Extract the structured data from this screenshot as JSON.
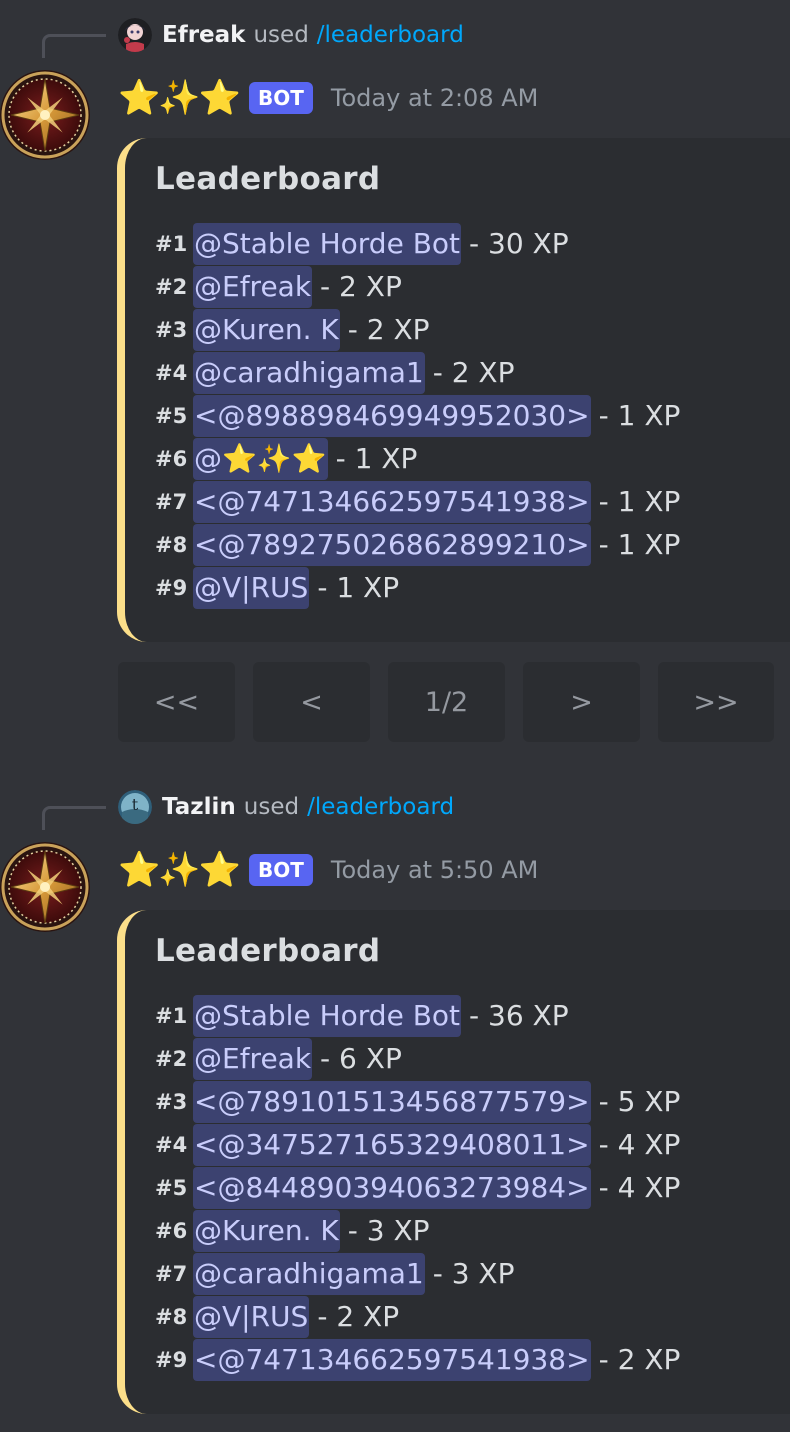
{
  "messages": [
    {
      "reply": {
        "user": "Efreak",
        "used": "used",
        "command": "/leaderboard"
      },
      "bot": {
        "name": "⭐✨⭐",
        "tag": "BOT",
        "timestamp": "Today at 2:08 AM"
      },
      "embed": {
        "title": "Leaderboard",
        "rows": [
          {
            "rank": "#1",
            "mention": "@Stable Horde Bot",
            "xp": "- 30 XP"
          },
          {
            "rank": "#2",
            "mention": "@Efreak",
            "xp": "- 2 XP"
          },
          {
            "rank": "#3",
            "mention": "@Kuren. K",
            "xp": "- 2 XP"
          },
          {
            "rank": "#4",
            "mention": "@caradhigama1",
            "xp": "- 2 XP"
          },
          {
            "rank": "#5",
            "mention": "<@898898469949952030>",
            "xp": "- 1 XP"
          },
          {
            "rank": "#6",
            "mention": "@⭐✨⭐",
            "xp": "- 1 XP"
          },
          {
            "rank": "#7",
            "mention": "<@747134662597541938>",
            "xp": "- 1 XP"
          },
          {
            "rank": "#8",
            "mention": "<@789275026862899210>",
            "xp": "- 1 XP"
          },
          {
            "rank": "#9",
            "mention": "@V|RUS",
            "xp": "- 1 XP"
          }
        ]
      },
      "pagination": {
        "first": "<<",
        "prev": "<",
        "page": "1/2",
        "next": ">",
        "last": ">>"
      }
    },
    {
      "reply": {
        "user": "Tazlin",
        "used": "used",
        "command": "/leaderboard"
      },
      "bot": {
        "name": "⭐✨⭐",
        "tag": "BOT",
        "timestamp": "Today at 5:50 AM"
      },
      "embed": {
        "title": "Leaderboard",
        "rows": [
          {
            "rank": "#1",
            "mention": "@Stable Horde Bot",
            "xp": "- 36 XP"
          },
          {
            "rank": "#2",
            "mention": "@Efreak",
            "xp": "- 6 XP"
          },
          {
            "rank": "#3",
            "mention": "<@789101513456877579>",
            "xp": "- 5 XP"
          },
          {
            "rank": "#4",
            "mention": "<@347527165329408011>",
            "xp": "- 4 XP"
          },
          {
            "rank": "#5",
            "mention": "<@844890394063273984>",
            "xp": "- 4 XP"
          },
          {
            "rank": "#6",
            "mention": "@Kuren. K",
            "xp": "- 3 XP"
          },
          {
            "rank": "#7",
            "mention": "@caradhigama1",
            "xp": "- 3 XP"
          },
          {
            "rank": "#8",
            "mention": "@V|RUS",
            "xp": "- 2 XP"
          },
          {
            "rank": "#9",
            "mention": "<@747134662597541938>",
            "xp": "- 2 XP"
          }
        ]
      }
    }
  ],
  "colors": {
    "background": "#313338",
    "embed_bg": "#2b2d31",
    "embed_border": "#fcdf8a",
    "mention_bg": "#3c4270",
    "mention_text": "#c9cdfb",
    "bot_tag": "#5865f2",
    "command": "#00a8fc"
  },
  "icons": {
    "bot_avatar": "gold-compass-star-emblem",
    "efreak_avatar": "anime-character-avatar",
    "tazlin_avatar": "letter-t-avatar"
  }
}
